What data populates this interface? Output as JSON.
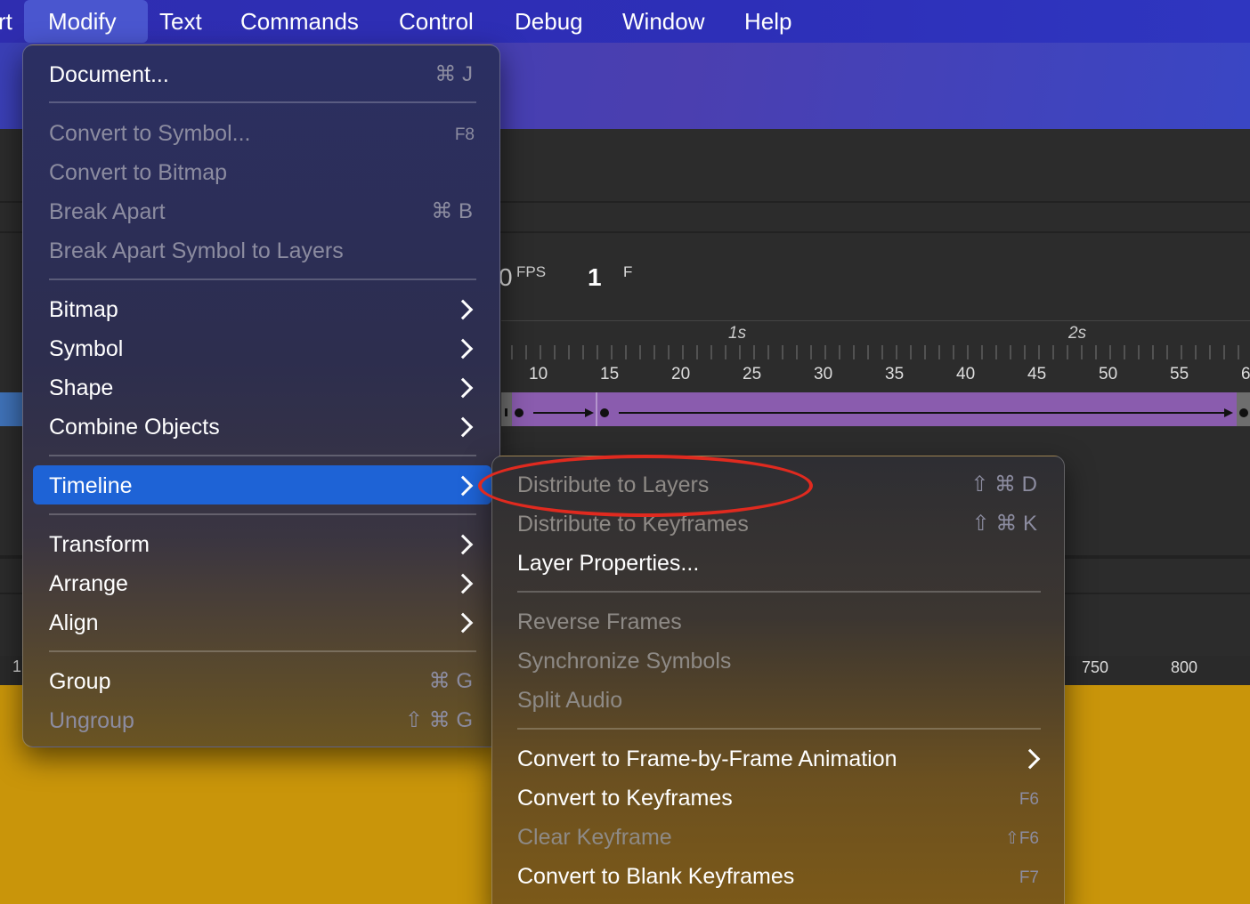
{
  "menubar": {
    "items": [
      "rt",
      "Modify",
      "Text",
      "Commands",
      "Control",
      "Debug",
      "Window",
      "Help"
    ]
  },
  "background": {
    "fps_value": "0",
    "fps_label": "FPS",
    "frame_value": "1",
    "frame_suffix": "F",
    "seconds": [
      "1s",
      "2s"
    ],
    "frame_ticks": [
      "10",
      "15",
      "20",
      "25",
      "30",
      "35",
      "40",
      "45",
      "50",
      "55",
      "6"
    ],
    "stage_ruler": [
      "1",
      "750",
      "800"
    ]
  },
  "modify_menu": {
    "document": {
      "label": "Document...",
      "shortcut": "⌘ J"
    },
    "convert_to_symbol": {
      "label": "Convert to Symbol...",
      "shortcut": "F8"
    },
    "convert_to_bitmap": {
      "label": "Convert to Bitmap"
    },
    "break_apart": {
      "label": "Break Apart",
      "shortcut": "⌘ B"
    },
    "break_apart_symbol": {
      "label": "Break Apart Symbol to Layers"
    },
    "bitmap": {
      "label": "Bitmap"
    },
    "symbol": {
      "label": "Symbol"
    },
    "shape": {
      "label": "Shape"
    },
    "combine_objects": {
      "label": "Combine Objects"
    },
    "timeline": {
      "label": "Timeline"
    },
    "transform": {
      "label": "Transform"
    },
    "arrange": {
      "label": "Arrange"
    },
    "align": {
      "label": "Align"
    },
    "group": {
      "label": "Group",
      "shortcut": "⌘ G"
    },
    "ungroup": {
      "label": "Ungroup",
      "shortcut": "⇧ ⌘ G"
    }
  },
  "timeline_menu": {
    "distribute_layers": {
      "label": "Distribute to Layers",
      "shortcut": "⇧ ⌘ D"
    },
    "distribute_keyframes": {
      "label": "Distribute to Keyframes",
      "shortcut": "⇧ ⌘ K"
    },
    "layer_properties": {
      "label": "Layer Properties..."
    },
    "reverse_frames": {
      "label": "Reverse Frames"
    },
    "synchronize_symbols": {
      "label": "Synchronize Symbols"
    },
    "split_audio": {
      "label": "Split Audio"
    },
    "convert_fbf": {
      "label": "Convert to Frame-by-Frame Animation"
    },
    "convert_keyframes": {
      "label": "Convert to Keyframes",
      "shortcut": "F6"
    },
    "clear_keyframe": {
      "label": "Clear Keyframe",
      "shortcut": "⇧F6"
    },
    "convert_blank": {
      "label": "Convert to Blank Keyframes",
      "shortcut": "F7"
    }
  },
  "colors": {
    "highlight": "#1e63d6",
    "annotation": "#e02a1f",
    "stage": "#c9950a",
    "track": "#8a5cae"
  }
}
